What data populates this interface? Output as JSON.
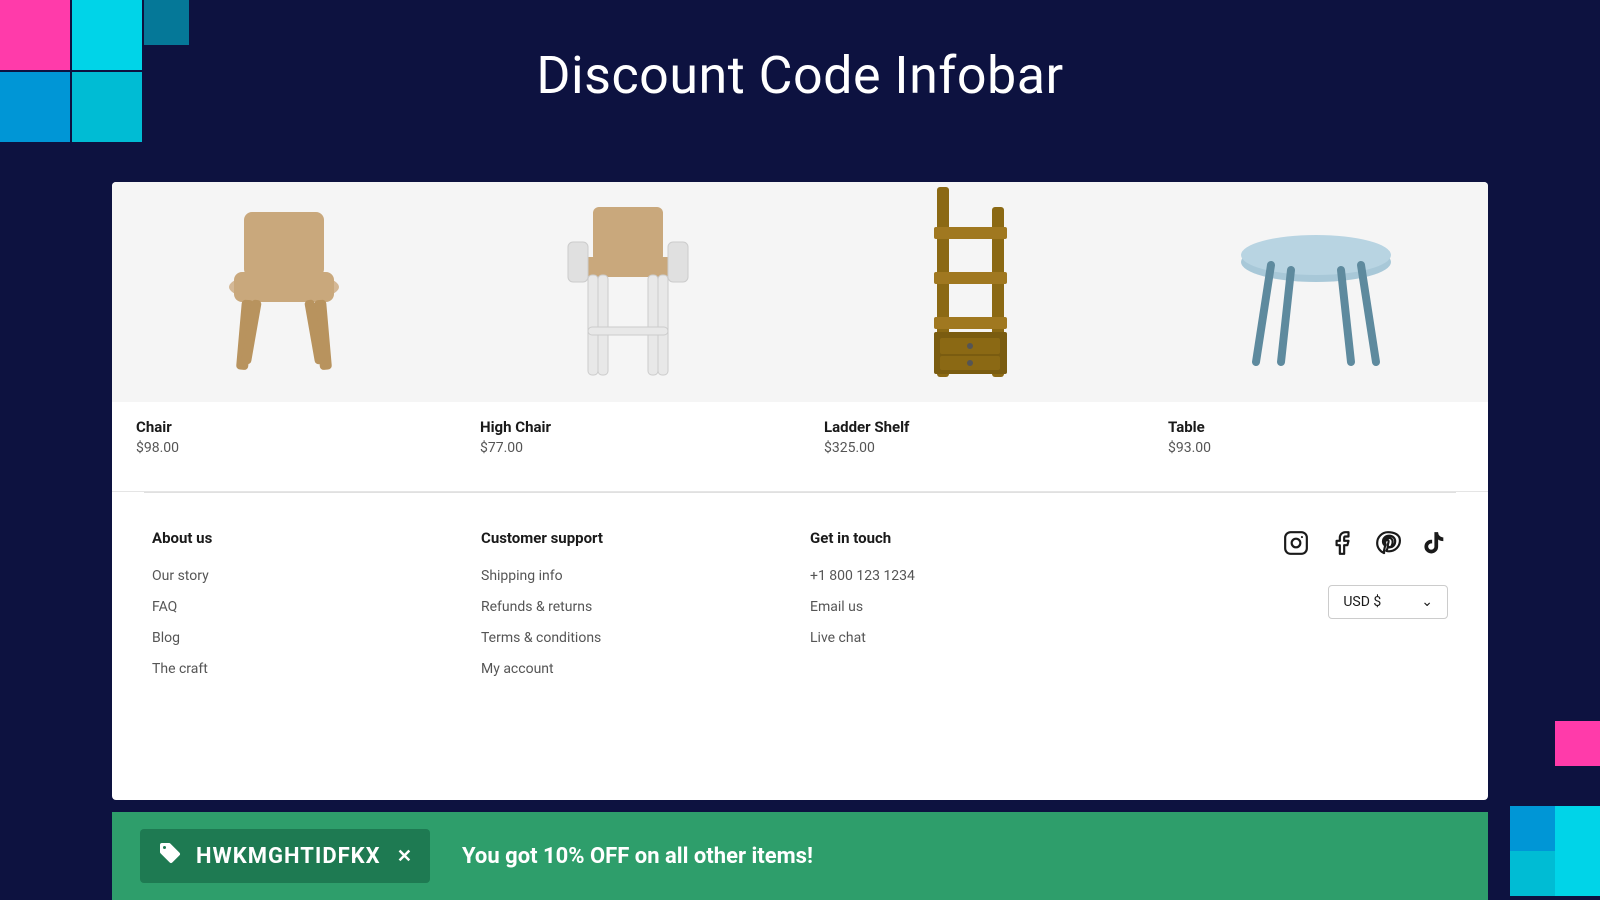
{
  "page": {
    "title": "Discount Code Infobar",
    "background": "#0d1240"
  },
  "products": [
    {
      "name": "Chair",
      "price": "$98.00"
    },
    {
      "name": "High Chair",
      "price": "$77.00"
    },
    {
      "name": "Ladder Shelf",
      "price": "$325.00"
    },
    {
      "name": "Table",
      "price": "$93.00"
    }
  ],
  "footer": {
    "about": {
      "heading": "About us",
      "links": [
        "Our story",
        "FAQ",
        "Blog",
        "The craft"
      ]
    },
    "support": {
      "heading": "Customer support",
      "links": [
        "Shipping info",
        "Refunds & returns",
        "Terms & conditions",
        "My account"
      ]
    },
    "contact": {
      "heading": "Get in touch",
      "links": [
        "+1 800 123 1234",
        "Email us",
        "Live chat"
      ]
    },
    "currency": {
      "selected": "USD $"
    }
  },
  "infobar": {
    "code": "HWKMGHTIDFKX",
    "message": "You got 10% OFF on all other items!"
  }
}
